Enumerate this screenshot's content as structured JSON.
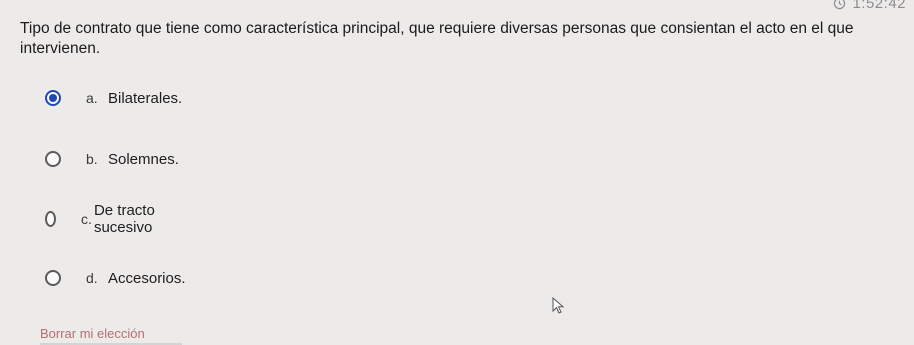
{
  "timer": {
    "icon": "clock-icon",
    "value": "1:52:42"
  },
  "question": {
    "text": "Tipo de contrato que tiene como característica principal, que requiere diversas personas que consientan el acto en el que intervienen."
  },
  "options": [
    {
      "letter": "a.",
      "text": "Bilaterales.",
      "selected": true
    },
    {
      "letter": "b.",
      "text": "Solemnes.",
      "selected": false
    },
    {
      "letter": "c.",
      "text": "De tracto sucesivo",
      "selected": false
    },
    {
      "letter": "d.",
      "text": "Accesorios.",
      "selected": false
    }
  ],
  "clear_choice": {
    "label": "Borrar mi elección"
  },
  "colors": {
    "accent": "#1f47b8",
    "background": "#ecebea"
  }
}
